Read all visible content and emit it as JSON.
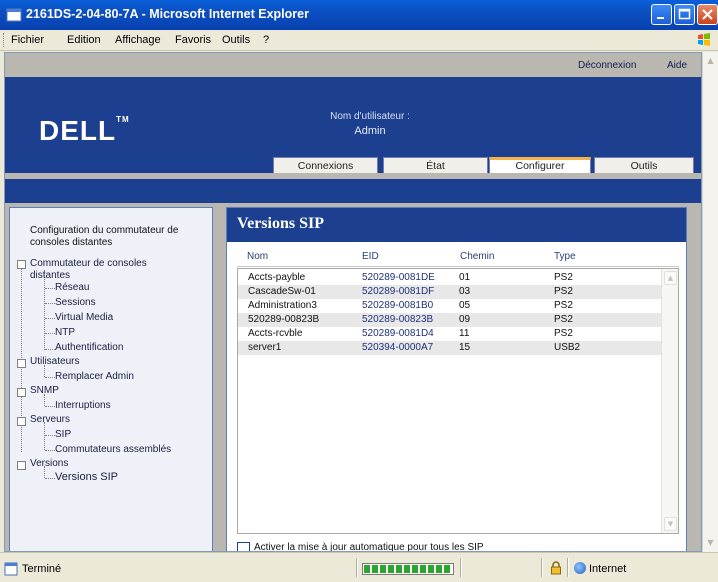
{
  "window": {
    "title": "2161DS-2-04-80-7A - Microsoft Internet Explorer"
  },
  "menu": {
    "items": [
      "Fichier",
      "Edition",
      "Affichage",
      "Favoris",
      "Outils",
      "?"
    ]
  },
  "topbar": {
    "logout": "Déconnexion",
    "help": "Aide"
  },
  "header": {
    "logo_text": "DELL",
    "user_label": "Nom d'utilisateur :",
    "user_value": "Admin"
  },
  "tabs": [
    {
      "label": "Connexions",
      "active": false
    },
    {
      "label": "État",
      "active": false
    },
    {
      "label": "Configurer",
      "active": true
    },
    {
      "label": "Outils",
      "active": false
    }
  ],
  "sidebar": {
    "title": "Configuration du commutateur de consoles distantes",
    "tree": {
      "switch_line1": "Commutateur de consoles",
      "switch_line2": "distantes",
      "network": "Réseau",
      "sessions": "Sessions",
      "virtual_media": "Virtual Media",
      "ntp": "NTP",
      "auth": "Authentification",
      "users": "Utilisateurs",
      "replace_admin": "Remplacer Admin",
      "snmp": "SNMP",
      "traps": "Interruptions",
      "servers": "Serveurs",
      "sip": "SIP",
      "cascaded": "Commutateurs assemblés",
      "versions": "Versions",
      "sip_versions": "Versions SIP"
    }
  },
  "main": {
    "title": "Versions SIP",
    "columns": [
      "Nom",
      "EID",
      "Chemin",
      "Type"
    ],
    "rows": [
      {
        "name": "Accts-payble",
        "eid": "520289-0081DE",
        "path": "01",
        "type": "PS2"
      },
      {
        "name": "CascadeSw-01",
        "eid": "520289-0081DF",
        "path": "03",
        "type": "PS2"
      },
      {
        "name": "Administration3",
        "eid": "520289-0081B0",
        "path": "05",
        "type": "PS2"
      },
      {
        "name": "520289-00823B",
        "eid": "520289-00823B",
        "path": "09",
        "type": "PS2"
      },
      {
        "name": "Accts-rcvble",
        "eid": "520289-0081D4",
        "path": "11",
        "type": "PS2"
      },
      {
        "name": "server1",
        "eid": "520394-0000A7",
        "path": "15",
        "type": "USB2"
      }
    ],
    "auto_update_label": "Activer la mise à jour automatique pour tous les SIP",
    "auto_update_checked": false
  },
  "statusbar": {
    "status": "Terminé",
    "progress": 1.0,
    "zone": "Internet"
  },
  "colors": {
    "dell_blue": "#1d3f8f",
    "tab_accent": "#f3b34a",
    "xp_title": "#0b4fc2"
  }
}
